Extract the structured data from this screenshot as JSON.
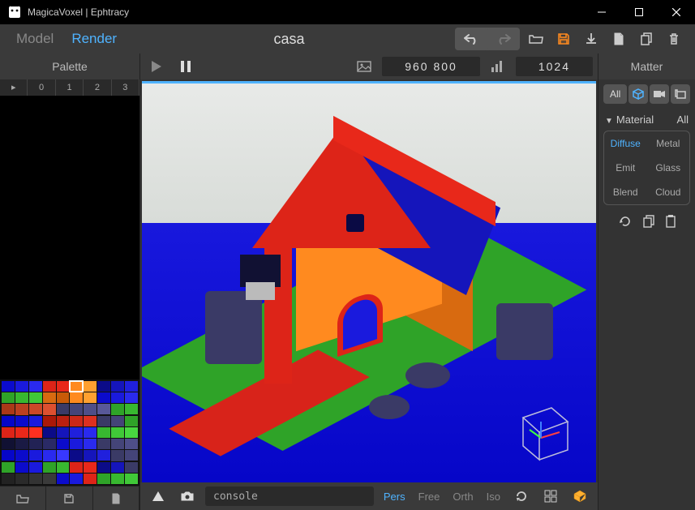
{
  "titlebar": {
    "title": "MagicaVoxel | Ephtracy"
  },
  "toolbar": {
    "modes": {
      "model": "Model",
      "render": "Render"
    },
    "project_name": "casa"
  },
  "left_panel": {
    "header": "Palette",
    "tabs": [
      "▸",
      "0",
      "1",
      "2",
      "3"
    ],
    "swatch_rows": [
      [
        "#0b0bcc",
        "#1a1add",
        "#2a2aee",
        "#dd2418",
        "#e8281a",
        "#ff8a1f",
        "#ffa030",
        "#0b0b88",
        "#1515bb",
        "#2020dd"
      ],
      [
        "#2fa328",
        "#38b830",
        "#40c838",
        "#d86a10",
        "#c85a08",
        "#ff8a1f",
        "#ffa030",
        "#0b0bcc",
        "#1a1add",
        "#2a2aee"
      ],
      [
        "#aa3818",
        "#bb4020",
        "#cc4828",
        "#dd5030",
        "#3a3a66",
        "#444478",
        "#4e4e88",
        "#585898",
        "#2fa328",
        "#38b830"
      ],
      [
        "#0606c8",
        "#0b0bcc",
        "#1a1add",
        "#aa1808",
        "#bb2010",
        "#cc2818",
        "#dd3020",
        "#3a3a66",
        "#444478",
        "#2fa328"
      ],
      [
        "#dd2418",
        "#e8281a",
        "#ff3020",
        "#0b0b88",
        "#1515bb",
        "#2020dd",
        "#2a2aee",
        "#38b830",
        "#40c838",
        "#48d840"
      ],
      [
        "#111133",
        "#1a1a44",
        "#222255",
        "#2a2a66",
        "#0b0bcc",
        "#1a1add",
        "#2a2aee",
        "#3a3a66",
        "#444478",
        "#4e4e88"
      ],
      [
        "#0606c8",
        "#0b0bcc",
        "#1a1add",
        "#2a2aee",
        "#3838ff",
        "#0b0b88",
        "#1515bb",
        "#2020dd",
        "#3a3a66",
        "#444478"
      ],
      [
        "#2fa328",
        "#0b0bcc",
        "#1a1add",
        "#2fa328",
        "#38b830",
        "#dd2418",
        "#e8281a",
        "#0b0b88",
        "#1515bb",
        "#3a3a66"
      ],
      [
        "#222",
        "#2a2a2a",
        "#333",
        "#3a3a3a",
        "#0b0bcc",
        "#1a1add",
        "#dd2418",
        "#2fa328",
        "#38b830",
        "#40c838"
      ]
    ],
    "selected_swatch": {
      "row": 0,
      "col": 5
    }
  },
  "center": {
    "dimensions": "960  800",
    "samples": "1024",
    "console_placeholder": "console",
    "view_modes": {
      "pers": "Pers",
      "free": "Free",
      "orth": "Orth",
      "iso": "Iso"
    },
    "active_view_mode": "pers"
  },
  "right_panel": {
    "header": "Matter",
    "filter_all": "All",
    "material_label": "Material",
    "material_all": "All",
    "materials": {
      "diffuse": "Diffuse",
      "metal": "Metal",
      "emit": "Emit",
      "glass": "Glass",
      "blend": "Blend",
      "cloud": "Cloud"
    },
    "active_material": "diffuse"
  },
  "icons": {
    "undo": "undo-icon",
    "redo": "redo-icon",
    "open": "folder-open-icon",
    "save": "save-icon",
    "download": "download-icon",
    "file": "file-icon",
    "copy": "copy-icon",
    "trash": "trash-icon",
    "play": "play-icon",
    "pause": "pause-icon",
    "image": "image-icon",
    "bars": "bars-icon",
    "folder": "folder-icon",
    "disk": "disk-icon",
    "page": "page-icon",
    "triangle": "triangle-up-icon",
    "camera": "camera-icon",
    "refresh": "refresh-icon",
    "layout": "layout-icon",
    "cube": "cube-icon",
    "cube3d": "cube3d-icon",
    "video": "video-icon",
    "screen": "screen-icon",
    "clipboard": "clipboard-icon"
  }
}
